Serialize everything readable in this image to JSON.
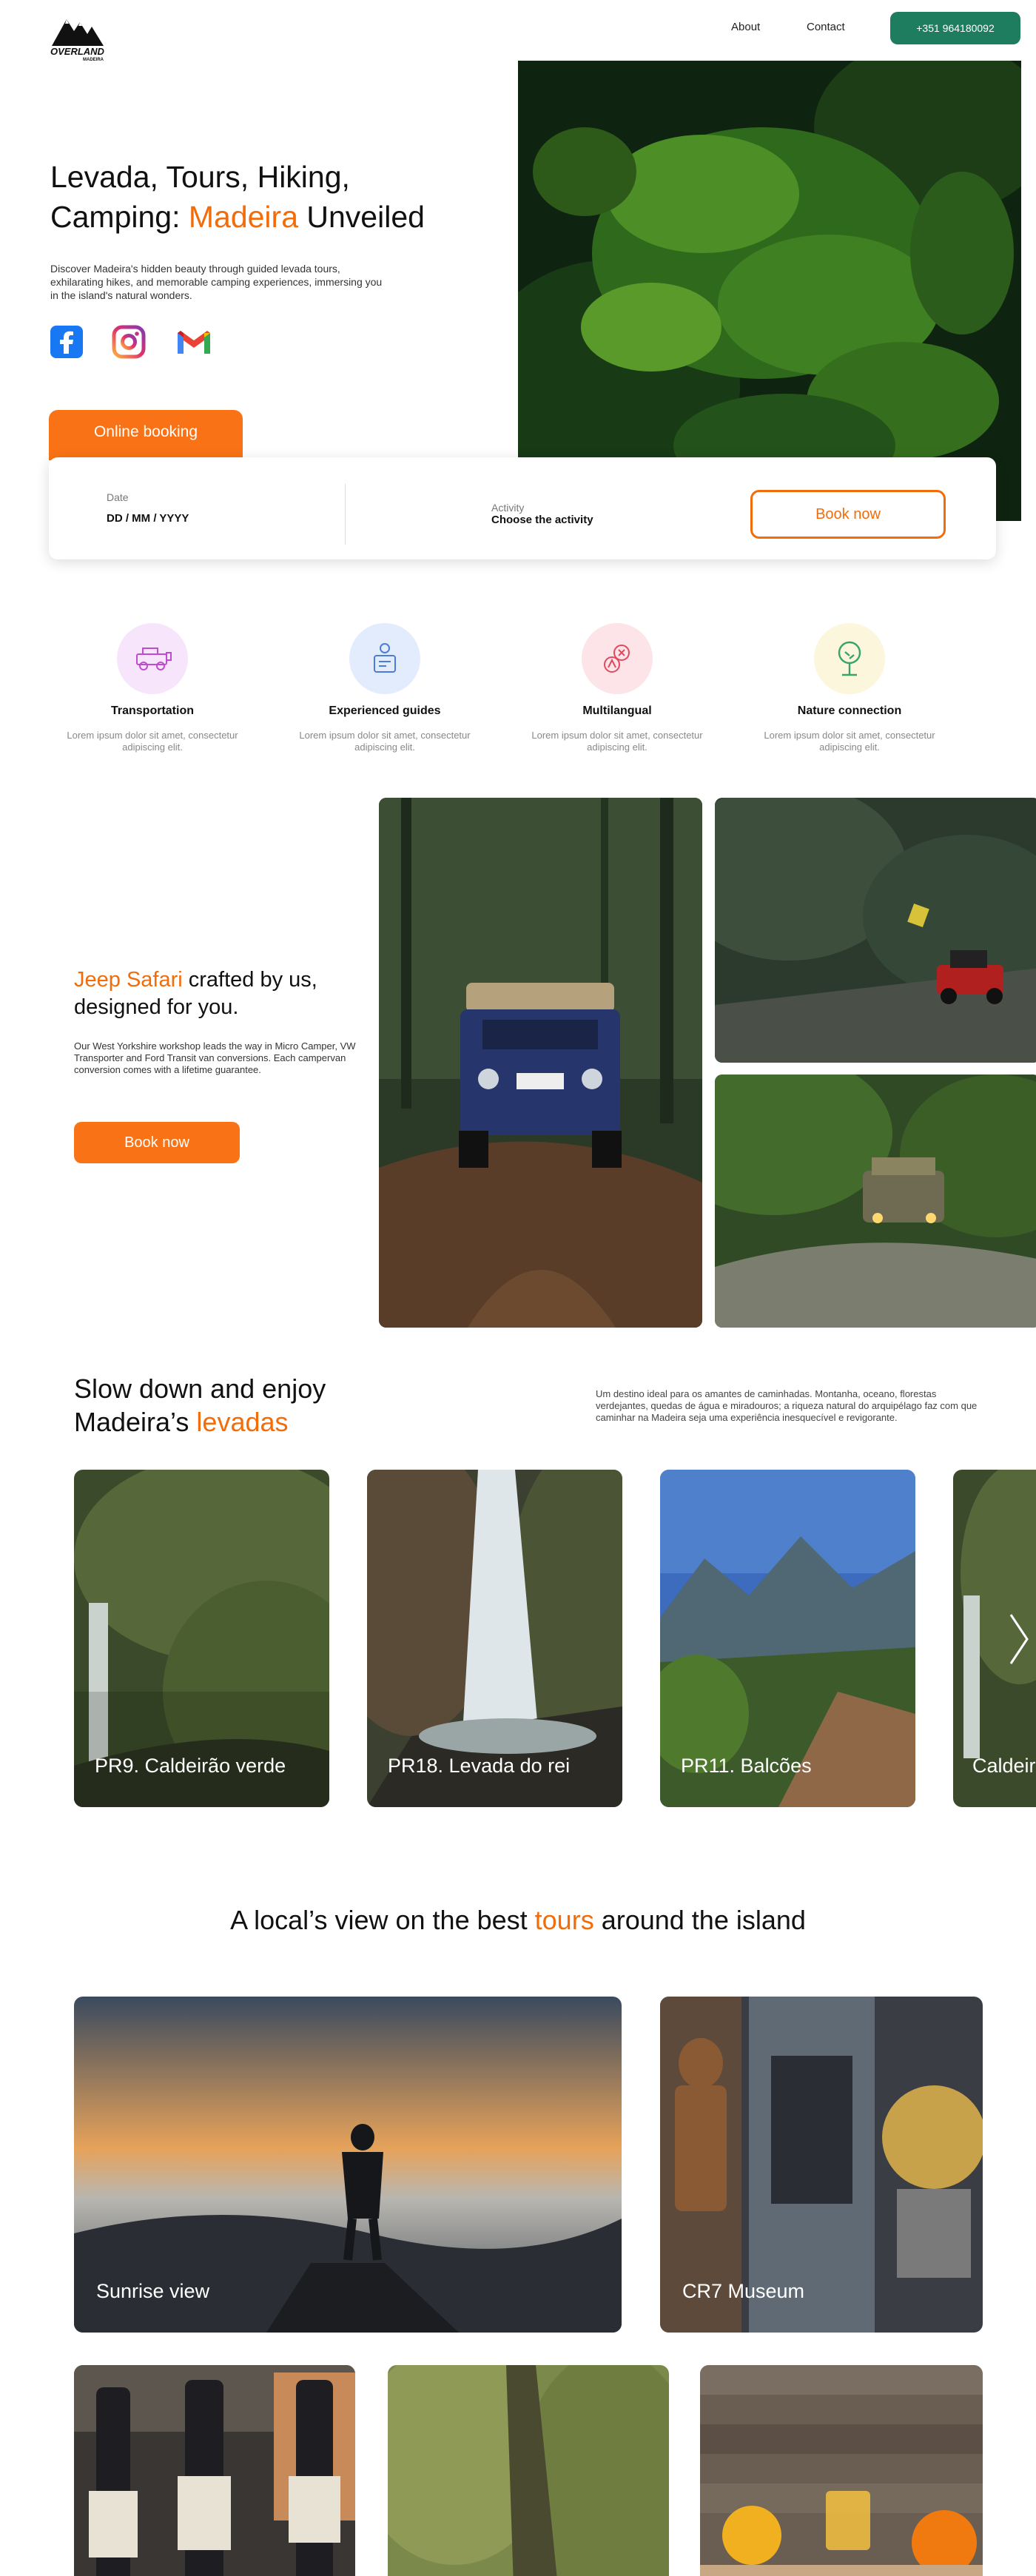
{
  "header": {
    "logo_text": "OVERLAND",
    "logo_sub": "MADEIRA",
    "nav": {
      "about": "About",
      "contact": "Contact"
    },
    "phone": "+351 964180092"
  },
  "hero": {
    "title_part1": "Levada, Tours, Hiking,",
    "title_part2": "Camping: ",
    "title_highlight": "Madeira",
    "title_part3": " Unveiled",
    "description": "Discover Madeira's hidden beauty through guided levada tours, exhilarating hikes, and memorable camping experiences, immersing you in the island's natural wonders.",
    "social_icons": [
      "facebook-icon",
      "instagram-icon",
      "gmail-icon"
    ]
  },
  "booking": {
    "tab_label": "Online booking",
    "date_label": "Date",
    "date_placeholder": "DD / MM / YYYY",
    "activity_label": "Activity",
    "activity_placeholder": "Choose the activity",
    "button": "Book now"
  },
  "features": [
    {
      "title": "Transportation",
      "desc": "Lorem ipsum dolor sit amet, consectetur adipiscing elit.",
      "icon": "jeep-icon",
      "bg": "#f7e6fb"
    },
    {
      "title": "Experienced guides",
      "desc": "Lorem ipsum dolor sit amet, consectetur adipiscing elit.",
      "icon": "guide-icon",
      "bg": "#e3ecfd"
    },
    {
      "title": "Multilangual",
      "desc": "Lorem ipsum dolor sit amet, consectetur adipiscing elit.",
      "icon": "translate-icon",
      "bg": "#fde4e8"
    },
    {
      "title": "Nature connection",
      "desc": "Lorem ipsum dolor sit amet, consectetur adipiscing elit.",
      "icon": "tree-icon",
      "bg": "#fbf6dc"
    }
  ],
  "jeep": {
    "title_highlight": "Jeep Safari",
    "title_rest": " crafted by us, designed for you.",
    "description": "Our West Yorkshire workshop leads the way in Micro Camper, VW Transporter and Ford Transit van conversions. Each campervan conversion comes with a lifetime guarantee.",
    "button": "Book now"
  },
  "levadas": {
    "title_part1": "Slow down and enjoy Madeira’s ",
    "title_highlight": "levadas",
    "description": "Um destino ideal para os amantes de caminhadas. Montanha, oceano, florestas verdejantes, quedas de água e miradouros; a riqueza natural do arquipélago faz com que caminhar na Madeira seja uma experiência inesquecível e revigorante.",
    "cards": [
      "PR9. Caldeirão verde",
      "PR18. Levada do rei",
      "PR11. Balcões",
      "Caldeirão"
    ]
  },
  "tours": {
    "title_part1": "A  local’s view on the best ",
    "title_highlight": "tours",
    "title_part2": " around the island",
    "cards": [
      "Sunrise view",
      "CR7 Museum"
    ]
  },
  "colors": {
    "accent": "#f97316",
    "brand_green": "#1e7d5e"
  }
}
